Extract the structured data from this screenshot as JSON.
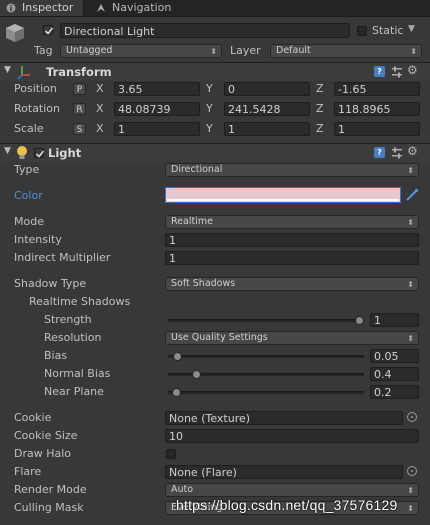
{
  "tabs": [
    {
      "label": "Inspector",
      "icon": "info-icon",
      "active": true
    },
    {
      "label": "Navigation",
      "icon": "navigation-icon",
      "active": false
    }
  ],
  "object": {
    "active_checked": true,
    "name": "Directional Light",
    "static_label": "Static",
    "static_checked": false,
    "tag_label": "Tag",
    "tag_value": "Untagged",
    "layer_label": "Layer",
    "layer_value": "Default"
  },
  "transform": {
    "title": "Transform",
    "rows": [
      {
        "label": "Position",
        "btn": "P",
        "x": "3.65",
        "y": "0",
        "z": "-1.65"
      },
      {
        "label": "Rotation",
        "btn": "R",
        "x": "48.08739",
        "y": "241.5428",
        "z": "118.8965"
      },
      {
        "label": "Scale",
        "btn": "S",
        "x": "1",
        "y": "1",
        "z": "1"
      }
    ],
    "axes": {
      "x": "X",
      "y": "Y",
      "z": "Z"
    }
  },
  "light": {
    "title": "Light",
    "enabled": true,
    "type_label": "Type",
    "type_value": "Directional",
    "color_label": "Color",
    "color_value": "#e9c7cf",
    "mode_label": "Mode",
    "mode_value": "Realtime",
    "intensity_label": "Intensity",
    "intensity_value": "1",
    "indirect_label": "Indirect Multiplier",
    "indirect_value": "1",
    "shadow_type_label": "Shadow Type",
    "shadow_type_value": "Soft Shadows",
    "realtime_shadows_label": "Realtime Shadows",
    "strength_label": "Strength",
    "strength_value": "1",
    "strength_fraction": 1.0,
    "resolution_label": "Resolution",
    "resolution_value": "Use Quality Settings",
    "bias_label": "Bias",
    "bias_value": "0.05",
    "bias_fraction": 0.025,
    "normal_bias_label": "Normal Bias",
    "normal_bias_value": "0.4",
    "normal_bias_fraction": 0.13,
    "near_plane_label": "Near Plane",
    "near_plane_value": "0.2",
    "near_plane_fraction": 0.02,
    "cookie_label": "Cookie",
    "cookie_value": "None (Texture)",
    "cookie_size_label": "Cookie Size",
    "cookie_size_value": "10",
    "draw_halo_label": "Draw Halo",
    "draw_halo_checked": false,
    "flare_label": "Flare",
    "flare_value": "None (Flare)",
    "render_mode_label": "Render Mode",
    "render_mode_value": "Auto",
    "culling_mask_label": "Culling Mask",
    "culling_mask_value": "Everything"
  },
  "watermark": "https://blog.csdn.net/qq_37576129",
  "colors": {
    "accent_blue": "#4e8cd8",
    "background": "#383838",
    "header": "#3c3c3c"
  }
}
